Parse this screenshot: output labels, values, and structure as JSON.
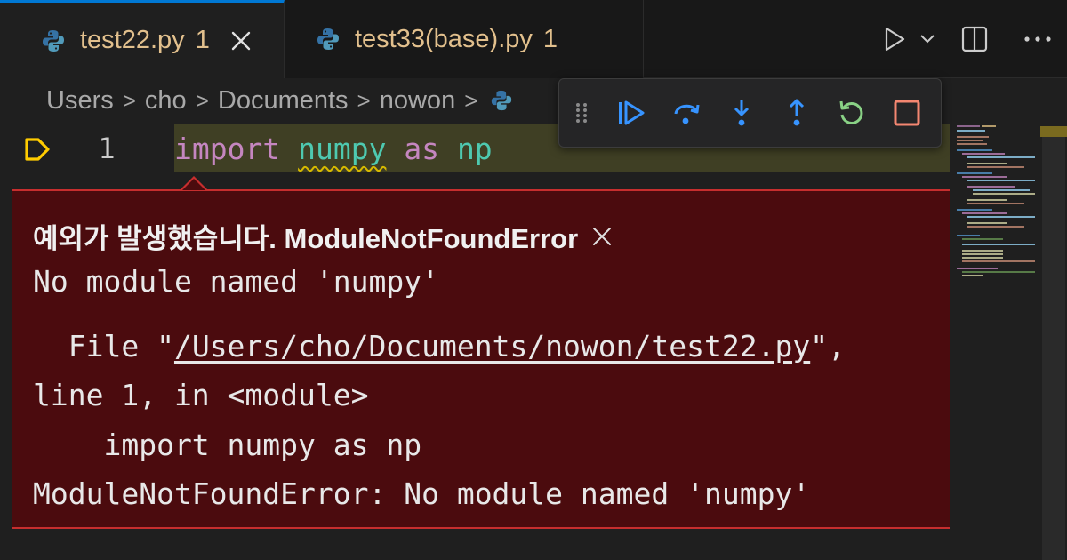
{
  "tabs": [
    {
      "name": "test22.py",
      "problems": "1",
      "active": true
    },
    {
      "name": "test33(base).py",
      "problems": "1",
      "active": false
    }
  ],
  "breadcrumb": [
    "Users",
    "cho",
    "Documents",
    "nowon"
  ],
  "breadcrumb_separator": ">",
  "editor": {
    "line_number": "1",
    "code": {
      "kw1": "import",
      "module": "numpy",
      "kw2": "as",
      "alias": "np"
    }
  },
  "debug_toolbar": {
    "icons": [
      "grip-icon",
      "continue-icon",
      "step-over-icon",
      "step-into-icon",
      "step-out-icon",
      "restart-icon",
      "stop-icon"
    ]
  },
  "exception": {
    "title": "예외가 발생했습니다. ModuleNotFoundError",
    "message": "No module named 'numpy'",
    "trace_prefix": "  File \"",
    "trace_path": "/Users/cho/Documents/nowon/test22.py",
    "trace_suffix": "\",",
    "trace_line": "line 1, in <module>",
    "trace_code": "    import numpy as np",
    "trace_error": "ModuleNotFoundError: No module named 'numpy'"
  },
  "colors": {
    "accent": "#0078d4",
    "exception_bg": "#4b0b0e",
    "exception_border": "#c72e2e",
    "keyword": "#c586c0",
    "debug_blue": "#3794ff",
    "debug_green": "#89d185",
    "debug_red": "#f48771",
    "tab_warning_text": "#e2c08d"
  }
}
